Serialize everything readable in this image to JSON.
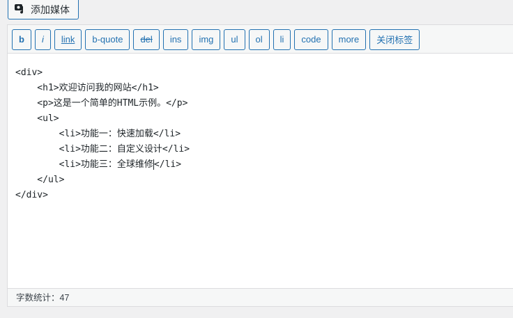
{
  "media_button": {
    "label": "添加媒体",
    "icon": "media-icon"
  },
  "toolbar": {
    "buttons": [
      {
        "key": "b",
        "label": "b"
      },
      {
        "key": "i",
        "label": "i"
      },
      {
        "key": "link",
        "label": "link"
      },
      {
        "key": "b-quote",
        "label": "b-quote"
      },
      {
        "key": "del",
        "label": "del"
      },
      {
        "key": "ins",
        "label": "ins"
      },
      {
        "key": "img",
        "label": "img"
      },
      {
        "key": "ul",
        "label": "ul"
      },
      {
        "key": "ol",
        "label": "ol"
      },
      {
        "key": "li",
        "label": "li"
      },
      {
        "key": "code",
        "label": "code"
      },
      {
        "key": "more",
        "label": "more"
      },
      {
        "key": "close",
        "label": "关闭标签"
      }
    ]
  },
  "content": {
    "lines": [
      "<div>",
      "    <h1>欢迎访问我的网站</h1>",
      "    <p>这是一个简单的HTML示例。</p>",
      "    <ul>",
      "        <li>功能一：快速加载</li>",
      "        <li>功能二：自定义设计</li>",
      "        <li>功能三：全球维修",
      "    </ul>",
      "</div>"
    ],
    "caret_suffix": "</li>"
  },
  "status": {
    "word_count": "字数统计：47"
  },
  "colors": {
    "accent": "#2271b1",
    "background": "#f0f0f1"
  }
}
